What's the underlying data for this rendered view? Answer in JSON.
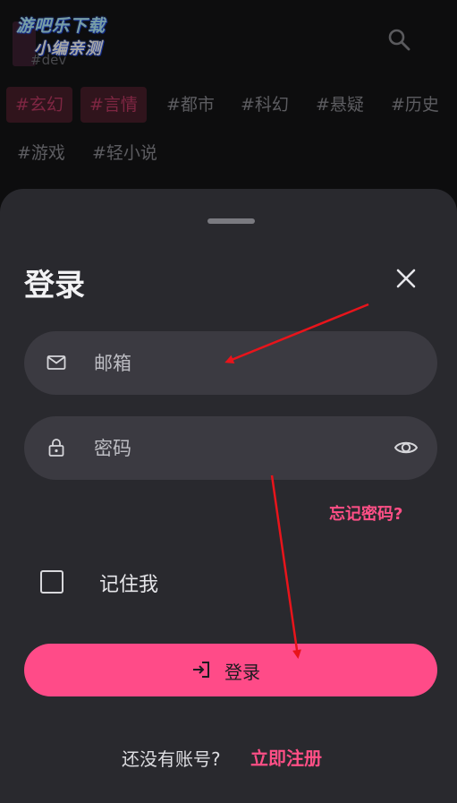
{
  "watermark": {
    "line1": "游吧乐下载",
    "line2": "小编亲测"
  },
  "header": {
    "subtitle": "#dev"
  },
  "tags": [
    {
      "label": "#玄幻",
      "active": true
    },
    {
      "label": "#言情",
      "active": true
    },
    {
      "label": "#都市",
      "active": false
    },
    {
      "label": "#科幻",
      "active": false
    },
    {
      "label": "#悬疑",
      "active": false
    },
    {
      "label": "#历史",
      "active": false
    },
    {
      "label": "#游戏",
      "active": false
    },
    {
      "label": "#轻小说",
      "active": false
    }
  ],
  "login_sheet": {
    "title": "登录",
    "email_placeholder": "邮箱",
    "password_placeholder": "密码",
    "forgot_password": "忘记密码?",
    "remember_me": "记住我",
    "remember_checked": false,
    "login_button": "登录",
    "no_account": "还没有账号?",
    "register_link": "立即注册"
  },
  "colors": {
    "accent": "#ff4b88",
    "link": "#ff4f86",
    "sheet_bg": "#29292e",
    "field_bg": "#3b3a41",
    "annotation_arrow": "#e8141b"
  },
  "icons": [
    "search-icon",
    "close-icon",
    "mail-icon",
    "lock-icon",
    "eye-icon",
    "login-enter-icon",
    "checkbox-icon"
  ]
}
